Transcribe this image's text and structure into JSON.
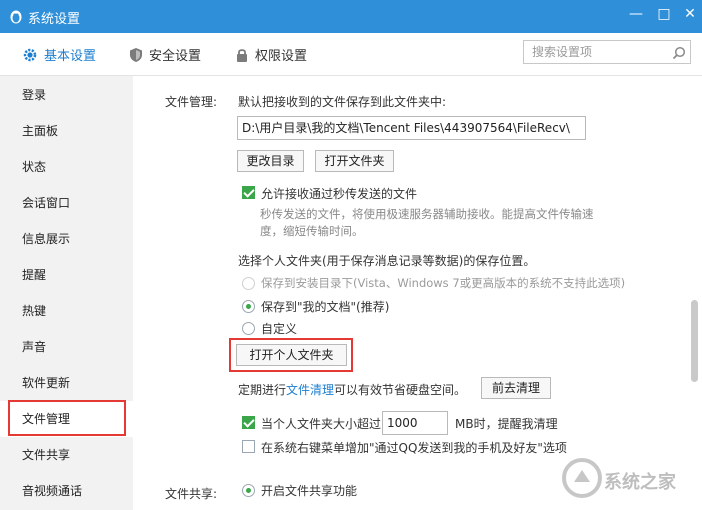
{
  "window": {
    "title": "系统设置",
    "controls": [
      "minimize",
      "maximize",
      "close"
    ]
  },
  "nav_tabs": [
    {
      "label": "基本设置",
      "icon": "gear-icon",
      "active": true
    },
    {
      "label": "安全设置",
      "icon": "shield-icon",
      "active": false
    },
    {
      "label": "权限设置",
      "icon": "lock-icon",
      "active": false
    }
  ],
  "search": {
    "placeholder": "搜索设置项",
    "value": ""
  },
  "sidebar": {
    "items": [
      {
        "label": "登录"
      },
      {
        "label": "主面板"
      },
      {
        "label": "状态"
      },
      {
        "label": "会话窗口"
      },
      {
        "label": "信息展示"
      },
      {
        "label": "提醒"
      },
      {
        "label": "热键"
      },
      {
        "label": "声音"
      },
      {
        "label": "软件更新"
      },
      {
        "label": "文件管理",
        "active": true
      },
      {
        "label": "文件共享"
      },
      {
        "label": "音视频通话"
      }
    ]
  },
  "file_management": {
    "section_label": "文件管理:",
    "save_prompt": "默认把接收到的文件保存到此文件夹中:",
    "path_value": "D:\\用户目录\\我的文档\\Tencent Files\\443907564\\FileRecv\\",
    "change_dir_button": "更改目录",
    "open_folder_button": "打开文件夹",
    "allow_fast_transfer": {
      "label": "允许接收通过秒传发送的文件",
      "checked": true
    },
    "fast_transfer_desc_1": "秒传发送的文件，将使用极速服务器辅助接收。能提高文件传输速",
    "fast_transfer_desc_2": "度，缩短传输时间。",
    "personal_folder_prompt": "选择个人文件夹(用于保存消息记录等数据)的保存位置。",
    "options": [
      {
        "label": "保存到安装目录下(Vista、Windows 7或更高版本的系统不支持此选项)",
        "selected": false,
        "disabled": true
      },
      {
        "label": "保存到\"我的文档\"(推荐)",
        "selected": true,
        "disabled": false
      },
      {
        "label": "自定义",
        "selected": false,
        "disabled": false
      }
    ],
    "open_personal_folder_button": "打开个人文件夹",
    "cleanup_text_pre": "定期进行",
    "cleanup_link": "文件清理",
    "cleanup_text_post": "可以有效节省硬盘空间。",
    "cleanup_button": "前去清理",
    "size_limit": {
      "label_pre": "当个人文件夹大小超过",
      "value": "1000",
      "label_post": "MB时，提醒我清理",
      "checked": true
    },
    "context_menu": {
      "label": "在系统右键菜单增加\"通过QQ发送到我的手机及好友\"选项",
      "checked": false
    }
  },
  "file_sharing": {
    "section_label": "文件共享:",
    "enable": {
      "label": "开启文件共享功能",
      "selected": true
    }
  },
  "watermark": {
    "text": "系统之家"
  },
  "colors": {
    "titlebar": "#2f8fd8",
    "accent": "#1e7fd0",
    "check_green": "#3ba54a",
    "highlight_red": "#e53935"
  }
}
